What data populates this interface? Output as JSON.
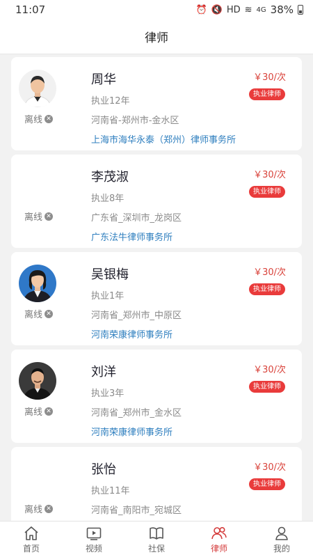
{
  "status_bar": {
    "time": "11:07",
    "network": "HD",
    "signal": "4G",
    "battery": "38%"
  },
  "header": {
    "title": "律师"
  },
  "lawyers": [
    {
      "name": "周华",
      "years": "执业12年",
      "region": "河南省-郑州市-金水区",
      "firm": "上海市海华永泰（郑州）律师事务所",
      "price": "￥30/次",
      "badge": "执业律师",
      "status": "离线",
      "avatar": "photo"
    },
    {
      "name": "李茂淑",
      "years": "执业8年",
      "region": "广东省_深圳市_龙岗区",
      "firm": "广东法牛律师事务所",
      "price": "￥30/次",
      "badge": "执业律师",
      "status": "离线",
      "avatar": "none"
    },
    {
      "name": "吴银梅",
      "years": "执业1年",
      "region": "河南省_郑州市_中原区",
      "firm": "河南荣康律师事务所",
      "price": "￥30/次",
      "badge": "执业律师",
      "status": "离线",
      "avatar": "photo"
    },
    {
      "name": "刘洋",
      "years": "执业3年",
      "region": "河南省_郑州市_金水区",
      "firm": "河南荣康律师事务所",
      "price": "￥30/次",
      "badge": "执业律师",
      "status": "离线",
      "avatar": "photo"
    },
    {
      "name": "张怡",
      "years": "执业11年",
      "region": "河南省_南阳市_宛城区",
      "firm": "",
      "price": "￥30/次",
      "badge": "执业律师",
      "status": "离线",
      "avatar": "none"
    }
  ],
  "nav": [
    {
      "label": "首页",
      "icon": "home-icon"
    },
    {
      "label": "视频",
      "icon": "video-icon"
    },
    {
      "label": "社保",
      "icon": "book-icon"
    },
    {
      "label": "律师",
      "icon": "people-icon",
      "active": true
    },
    {
      "label": "我的",
      "icon": "person-icon"
    }
  ],
  "colors": {
    "accent": "#d43b3b",
    "badge": "#e93b3b",
    "link": "#2f7fbf"
  }
}
